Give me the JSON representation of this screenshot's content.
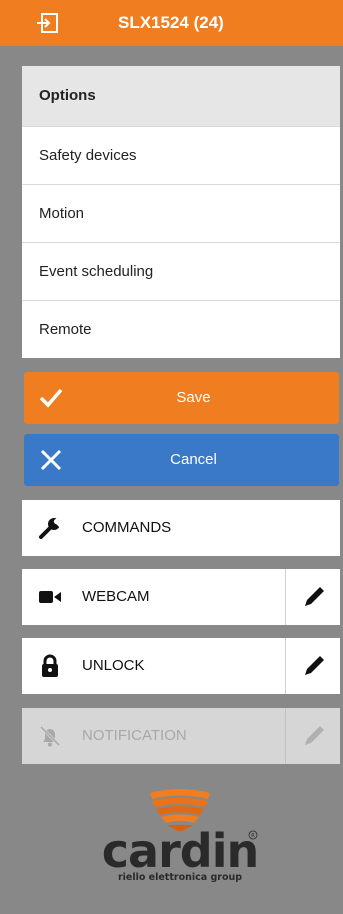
{
  "header": {
    "title": "SLX1524 (24)",
    "icon": "exit-icon",
    "color": "#f07d20"
  },
  "menu": {
    "header": "Options",
    "items": [
      {
        "label": "Safety devices"
      },
      {
        "label": "Motion"
      },
      {
        "label": "Event scheduling"
      },
      {
        "label": "Remote"
      }
    ]
  },
  "buttons": {
    "save": {
      "label": "Save",
      "icon": "checkmark-icon",
      "color": "#f07d20"
    },
    "cancel": {
      "label": "Cancel",
      "icon": "close-icon",
      "color": "#3a78c8"
    }
  },
  "actions": [
    {
      "label": "COMMANDS",
      "icon": "wrench-icon"
    },
    {
      "label": "WEBCAM",
      "icon": "video-camera-icon",
      "editable": true
    },
    {
      "label": "UNLOCK",
      "icon": "lock-icon",
      "editable": true
    },
    {
      "label": "NOTIFICATION",
      "icon": "bell-muted-icon",
      "editable": true,
      "disabled": true
    }
  ],
  "logo": {
    "brand": "cardin",
    "tagline": "riello elettronica group"
  }
}
